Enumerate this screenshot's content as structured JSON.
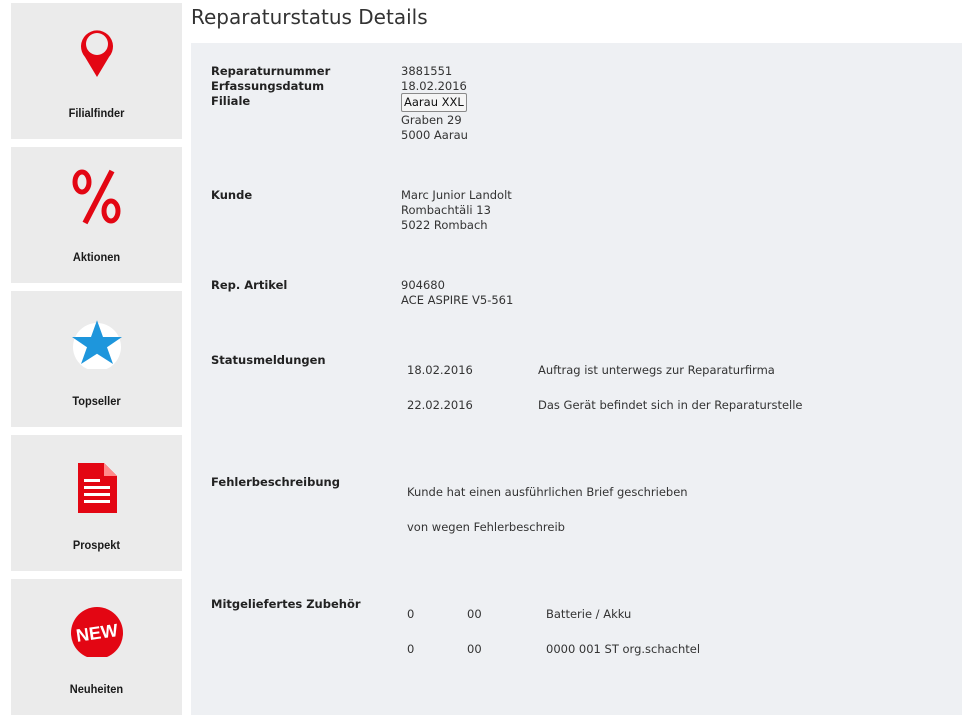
{
  "sidebar": {
    "items": [
      {
        "label": "Filialfinder",
        "icon": "map-pin-icon"
      },
      {
        "label": "Aktionen",
        "icon": "percent-icon"
      },
      {
        "label": "Topseller",
        "icon": "star-icon"
      },
      {
        "label": "Prospekt",
        "icon": "document-icon"
      },
      {
        "label": "Neuheiten",
        "icon": "new-badge-icon"
      }
    ]
  },
  "page": {
    "title": "Reparaturstatus Details"
  },
  "details": {
    "repair_number_label": "Reparaturnummer",
    "repair_number": "3881551",
    "capture_date_label": "Erfassungsdatum",
    "capture_date": "18.02.2016",
    "branch_label": "Filiale",
    "branch_button": "Aarau XXL",
    "branch_street": "Graben 29",
    "branch_city": "5000 Aarau",
    "customer_label": "Kunde",
    "customer_name": "Marc Junior Landolt",
    "customer_street": "Rombachtäli 13",
    "customer_city": "5022 Rombach",
    "article_label": "Rep. Artikel",
    "article_number": "904680",
    "article_name": "ACE ASPIRE V5-561"
  },
  "status": {
    "label": "Statusmeldungen",
    "rows": [
      {
        "date": "18.02.2016",
        "message": "Auftrag ist unterwegs zur Reparaturfirma"
      },
      {
        "date": "22.02.2016",
        "message": "Das Gerät befindet sich in der Reparaturstelle"
      }
    ]
  },
  "fault": {
    "label": "Fehlerbeschreibung",
    "lines": [
      "Kunde hat einen ausführlichen Brief geschrieben",
      "von wegen Fehlerbeschreib"
    ]
  },
  "accessories": {
    "label": "Mitgeliefertes Zubehör",
    "rows": [
      {
        "col1": "0",
        "col2": "00",
        "description": "Batterie / Akku"
      },
      {
        "col1": "0",
        "col2": "00",
        "description": "0000 001 ST org.schachtel"
      }
    ]
  },
  "colors": {
    "accent_red": "#e30613",
    "star_blue": "#1e96dc",
    "panel_bg": "#eef0f3",
    "tile_bg": "#ebebeb"
  }
}
